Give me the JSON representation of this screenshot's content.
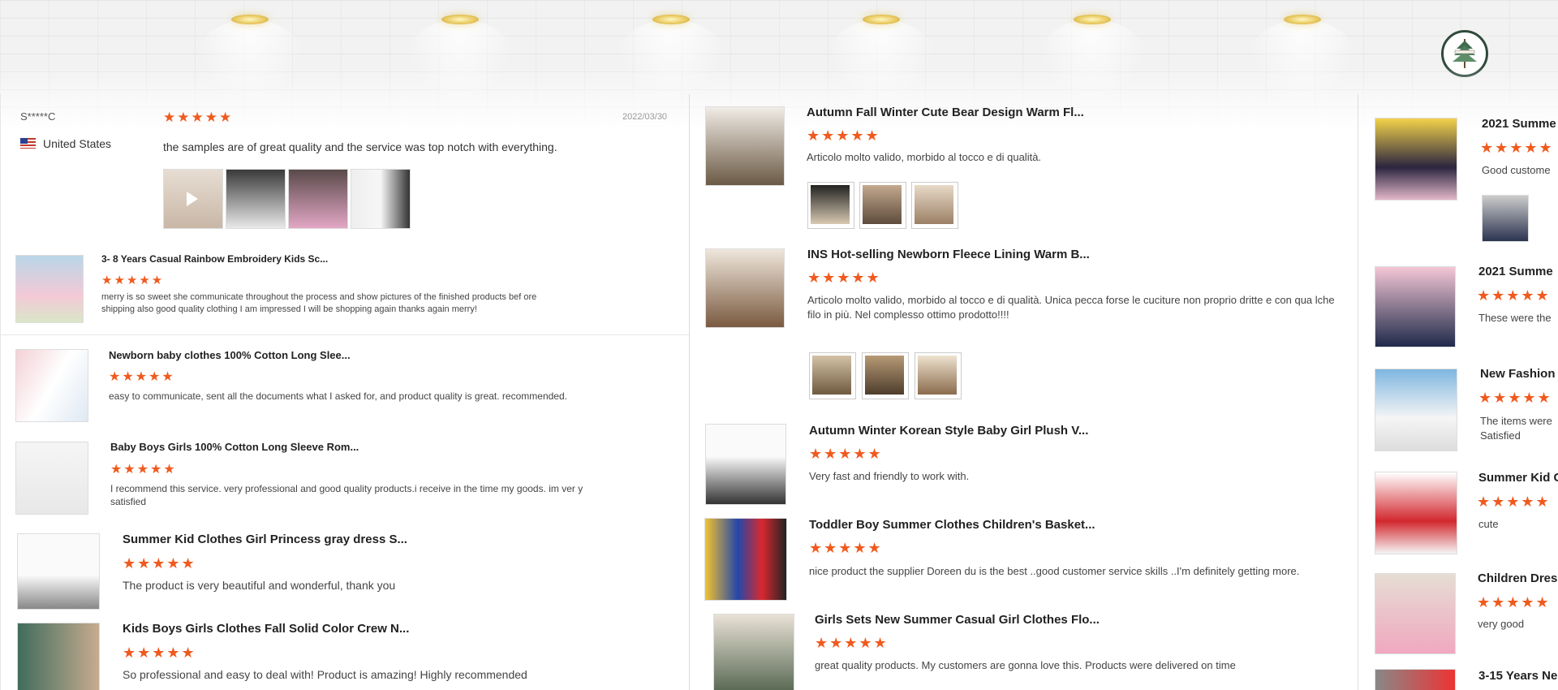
{
  "banner": {
    "lamps": 6
  },
  "featured_review": {
    "user": "S*****C",
    "country": "United States",
    "date": "2022/03/30",
    "stars": "★★★★★",
    "text": "the samples are of great quality and the service was top notch with everything."
  },
  "col1": [
    {
      "title": "3- 8 Years Casual Rainbow Embroidery Kids Sc...",
      "stars": "★★★★★",
      "text": "merry is so sweet she communicate throughout the process and show pictures of the finished products bef ore shipping also good quality clothing I am impressed I will be shopping again thanks again merry!"
    },
    {
      "title": "Newborn baby clothes 100% Cotton Long Slee...",
      "stars": "★★★★★",
      "text": "easy to communicate, sent all the documents what I asked for, and product quality is great. recommended."
    },
    {
      "title": "Baby Boys Girls 100% Cotton Long Sleeve Rom...",
      "stars": "★★★★★",
      "text": "I recommend this service. very professional and good quality products.i receive in the time my goods. im ver y satisfied"
    },
    {
      "title": "Summer Kid Clothes Girl Princess gray dress S...",
      "stars": "★★★★★",
      "text": "The product is very beautiful and wonderful, thank you"
    },
    {
      "title": "Kids Boys Girls Clothes Fall Solid Color Crew N...",
      "stars": "★★★★★",
      "text": "So professional and easy to deal with! Product is amazing! Highly recommended"
    }
  ],
  "col2": [
    {
      "title": "Autumn Fall Winter Cute Bear Design Warm Fl...",
      "stars": "★★★★★",
      "text": "Articolo molto valido, morbido al tocco e di qualità."
    },
    {
      "title": "INS Hot-selling Newborn Fleece Lining Warm B...",
      "stars": "★★★★★",
      "text": "Articolo molto valido, morbido al tocco e di qualità. Unica pecca forse le cuciture non proprio dritte e con qua lche filo in più. Nel complesso ottimo prodotto!!!!"
    },
    {
      "title": "Autumn Winter Korean Style Baby Girl Plush V...",
      "stars": "★★★★★",
      "text": "Very fast and friendly to work with."
    },
    {
      "title": "Toddler Boy Summer Clothes Children's Basket...",
      "stars": "★★★★★",
      "text": "nice product the supplier Doreen du is the best ..good customer service skills ..I'm definitely getting more."
    },
    {
      "title": "Girls Sets New Summer Casual Girl Clothes Flo...",
      "stars": "★★★★★",
      "text": "great quality products. My customers are gonna love this. Products were delivered on time"
    }
  ],
  "col3": [
    {
      "title": "2021 Summe",
      "stars": "★★★★★",
      "text": "Good custome"
    },
    {
      "title": "2021 Summe",
      "stars": "★★★★★",
      "text": "These were the"
    },
    {
      "title": "New Fashion",
      "stars": "★★★★★",
      "text": "The items were Satisfied"
    },
    {
      "title": "Summer Kid C",
      "stars": "★★★★★",
      "text": "cute"
    },
    {
      "title": "Children Dres",
      "stars": "★★★★★",
      "text": "very good"
    },
    {
      "title": "3-15 Years Ne",
      "stars": "",
      "text": ""
    }
  ]
}
